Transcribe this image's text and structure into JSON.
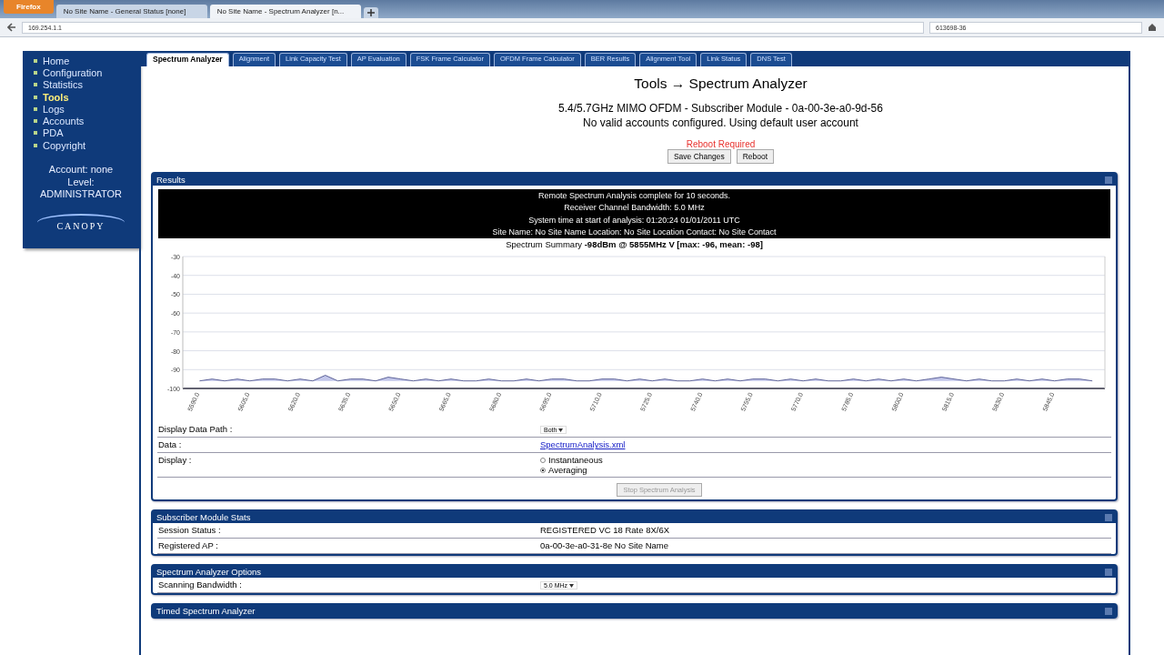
{
  "browser": {
    "menu_button": "Firefox",
    "tabs": [
      {
        "label": "No Site Name - General Status [none]",
        "selected": false
      },
      {
        "label": "No Site Name - Spectrum Analyzer [n...",
        "selected": true
      }
    ],
    "address": "169.254.1.1",
    "search": "613698-36"
  },
  "sidebar": {
    "items": [
      {
        "label": "Home",
        "selected": false
      },
      {
        "label": "Configuration",
        "selected": false
      },
      {
        "label": "Statistics",
        "selected": false
      },
      {
        "label": "Tools",
        "selected": true
      },
      {
        "label": "Logs",
        "selected": false
      },
      {
        "label": "Accounts",
        "selected": false
      },
      {
        "label": "PDA",
        "selected": false
      },
      {
        "label": "Copyright",
        "selected": false
      }
    ],
    "account": "Account: none",
    "level": "Level:",
    "role": "ADMINISTRATOR",
    "logo": "CANOPY"
  },
  "tabs": [
    {
      "label": "Spectrum Analyzer",
      "selected": true
    },
    {
      "label": "Alignment",
      "selected": false
    },
    {
      "label": "Link Capacity Test",
      "selected": false
    },
    {
      "label": "AP Evaluation",
      "selected": false
    },
    {
      "label": "FSK Frame Calculator",
      "selected": false
    },
    {
      "label": "OFDM Frame Calculator",
      "selected": false
    },
    {
      "label": "BER Results",
      "selected": false
    },
    {
      "label": "Alignment Tool",
      "selected": false
    },
    {
      "label": "Link Status",
      "selected": false
    },
    {
      "label": "DNS Test",
      "selected": false
    }
  ],
  "title": "Tools → Spectrum Analyzer",
  "device": "5.4/5.7GHz MIMO OFDM - Subscriber Module - 0a-00-3e-a0-9d-56",
  "account_note": "No valid accounts configured. Using default user account",
  "warning": "Reboot Required",
  "buttons": [
    "Save Changes",
    "Reboot"
  ],
  "results": {
    "title": "Results",
    "info": [
      "Remote Spectrum Analysis complete for 10 seconds.",
      "Receiver Channel Bandwidth: 5.0 MHz",
      "System time at start of analysis: 01:20:24 01/01/2011 UTC",
      "Site Name: No Site Name  Location: No Site Location  Contact: No Site Contact"
    ],
    "summary": "Spectrum Summary **-98dBm @ 5855MHz V [max: -96, mean: -98]**",
    "chart_data": {
      "type": "area",
      "grid": true,
      "ylim": [
        -100,
        -30
      ],
      "yticks": [
        -30,
        -40,
        -50,
        -60,
        -70,
        -80,
        -90,
        -100
      ],
      "xlim": [
        5585,
        5860
      ],
      "xticks": [
        {
          "value": 5590,
          "label": "5590.0"
        },
        {
          "value": 5605,
          "label": "5605.0"
        },
        {
          "value": 5620,
          "label": "5620.0"
        },
        {
          "value": 5635,
          "label": "5635.0"
        },
        {
          "value": 5650,
          "label": "5650.0"
        },
        {
          "value": 5665,
          "label": "5665.0"
        },
        {
          "value": 5680,
          "label": "5680.0"
        },
        {
          "value": 5695,
          "label": "5695.0"
        },
        {
          "value": 5710,
          "label": "5710.0"
        },
        {
          "value": 5725,
          "label": "5725.0"
        },
        {
          "value": 5740,
          "label": "5740.0"
        },
        {
          "value": 5755,
          "label": "5755.0"
        },
        {
          "value": 5770,
          "label": "5770.0"
        },
        {
          "value": 5785,
          "label": "5785.0"
        },
        {
          "value": 5800,
          "label": "5800.0"
        },
        {
          "value": 5815,
          "label": "5815.0"
        },
        {
          "value": 5830,
          "label": "5830.0"
        },
        {
          "value": 5845,
          "label": "5845.0"
        }
      ],
      "x": [
        5590,
        5593.75,
        5597.5,
        5601.25,
        5605,
        5608.75,
        5612.5,
        5616.25,
        5620,
        5623.75,
        5627.5,
        5631.25,
        5635,
        5638.75,
        5642.5,
        5646.25,
        5650,
        5653.75,
        5657.5,
        5661.25,
        5665,
        5668.75,
        5672.5,
        5676.25,
        5680,
        5683.75,
        5687.5,
        5691.25,
        5695,
        5698.75,
        5702.5,
        5706.25,
        5710,
        5713.75,
        5717.5,
        5721.25,
        5725,
        5728.75,
        5732.5,
        5736.25,
        5740,
        5743.75,
        5747.5,
        5751.25,
        5755,
        5758.75,
        5762.5,
        5766.25,
        5770,
        5773.75,
        5777.5,
        5781.25,
        5785,
        5788.75,
        5792.5,
        5796.25,
        5800,
        5803.75,
        5807.5,
        5811.25,
        5815,
        5818.75,
        5822.5,
        5826.25,
        5830,
        5833.75,
        5837.5,
        5841.25,
        5845,
        5848.75,
        5852.5,
        5856.25
      ],
      "series": [
        {
          "color": "#9aa0dc",
          "values": [
            -96,
            -95,
            -96,
            -95,
            -96,
            -95,
            -95,
            -96,
            -95,
            -96,
            -93,
            -96,
            -95,
            -95,
            -96,
            -94,
            -95,
            -96,
            -95,
            -96,
            -95,
            -96,
            -96,
            -95,
            -96,
            -96,
            -95,
            -96,
            -95,
            -95,
            -96,
            -96,
            -95,
            -95,
            -96,
            -95,
            -96,
            -95,
            -96,
            -96,
            -95,
            -96,
            -95,
            -96,
            -95,
            -95,
            -96,
            -95,
            -96,
            -95,
            -96,
            -96,
            -95,
            -96,
            -95,
            -96,
            -95,
            -96,
            -95,
            -94,
            -95,
            -96,
            -95,
            -96,
            -96,
            -95,
            -96,
            -95,
            -96,
            -95,
            -95,
            -96
          ]
        }
      ]
    },
    "rows": [
      {
        "kind": "select",
        "label": "Display Data Path :",
        "value": "Both"
      },
      {
        "kind": "link",
        "label": "Data :",
        "value": "SpectrumAnalysis.xml"
      },
      {
        "kind": "radio",
        "label": "Display :",
        "options": [
          {
            "label": "Instantaneous",
            "selected": false
          },
          {
            "label": "Averaging",
            "selected": true
          }
        ]
      }
    ],
    "action": {
      "label": "Stop Spectrum Analysis",
      "disabled": true
    }
  },
  "panels": [
    {
      "title": "Subscriber Module Stats",
      "rows": [
        {
          "kind": "text",
          "label": "Session Status :",
          "value": "REGISTERED VC 18 Rate 8X/6X"
        },
        {
          "kind": "text",
          "label": "Registered AP :",
          "value": "0a-00-3e-a0-31-8e No Site Name"
        }
      ]
    },
    {
      "title": "Spectrum Analyzer Options",
      "rows": [
        {
          "kind": "select",
          "label": "Scanning Bandwidth :",
          "value": "5.0 MHz"
        }
      ]
    },
    {
      "title": "Timed Spectrum Analyzer"
    }
  ]
}
